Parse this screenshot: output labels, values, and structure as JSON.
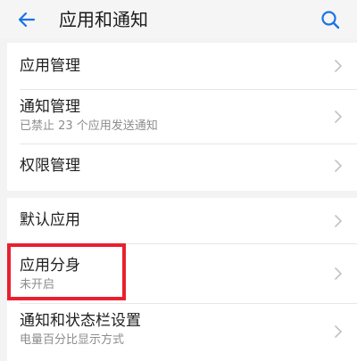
{
  "header": {
    "title": "应用和通知",
    "back_icon": "arrow-left-icon",
    "search_icon": "search-icon",
    "accent_color": "#1a73e8"
  },
  "groups": [
    {
      "items": [
        {
          "title": "应用管理",
          "subtitle": ""
        },
        {
          "title": "通知管理",
          "subtitle": "已禁止 23 个应用发送通知"
        },
        {
          "title": "权限管理",
          "subtitle": ""
        }
      ]
    },
    {
      "items": [
        {
          "title": "默认应用",
          "subtitle": ""
        },
        {
          "title": "应用分身",
          "subtitle": "未开启"
        },
        {
          "title": "通知和状态栏设置",
          "subtitle": "电量百分比显示方式"
        }
      ]
    }
  ],
  "highlight_color": "#e8202f"
}
